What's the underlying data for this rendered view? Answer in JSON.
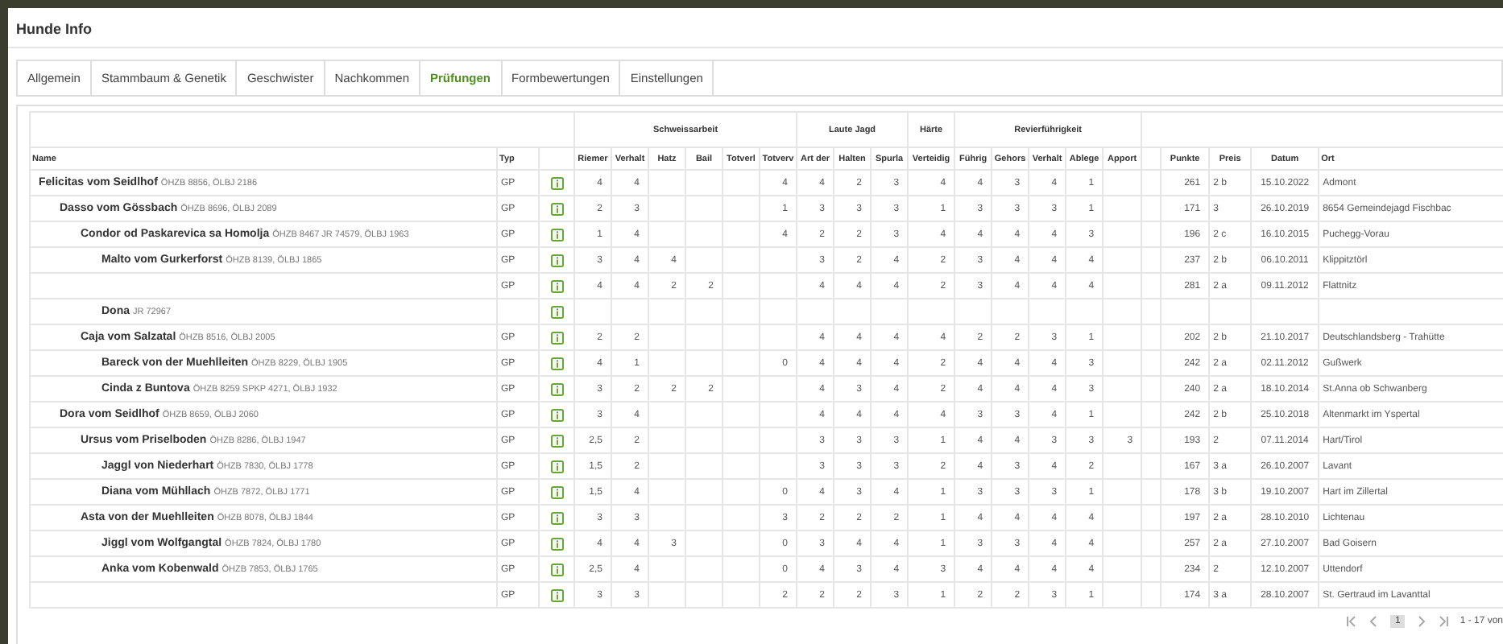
{
  "dialog": {
    "title": "Hunde Info"
  },
  "tabs": [
    {
      "label": "Allgemein",
      "selected": false
    },
    {
      "label": "Stammbaum & Genetik",
      "selected": false
    },
    {
      "label": "Geschwister",
      "selected": false
    },
    {
      "label": "Nachkommen",
      "selected": false
    },
    {
      "label": "Prüfungen",
      "selected": true
    },
    {
      "label": "Formbewertungen",
      "selected": false
    },
    {
      "label": "Einstellungen",
      "selected": false
    }
  ],
  "table": {
    "lead_columns": [
      "Name",
      "Typ"
    ],
    "column_groups": [
      {
        "label": "Schweissarbeit",
        "columns": [
          "Riemer",
          "Verhalt",
          "Hatz",
          "Bail",
          "Totverl",
          "Totverv"
        ]
      },
      {
        "label": "Laute Jagd",
        "columns": [
          "Art der",
          "Halten",
          "Spurla"
        ]
      },
      {
        "label": "Härte",
        "columns": [
          "Verteidig"
        ]
      },
      {
        "label": "Revierführigkeit",
        "columns": [
          "Führig",
          "Gehors",
          "Verhalt",
          "Ablege",
          "Apport"
        ]
      }
    ],
    "trail_columns": [
      "Punkte",
      "Preis",
      "Datum",
      "Ort"
    ],
    "rows": [
      {
        "name": "Felicitas vom Seidlhof",
        "reg": "ÖHZB 8856, ÖLBJ 2186",
        "typ": "GP",
        "scores": {
          "riemen": "4",
          "verhalten": "4",
          "totverweiser": "4",
          "art": "4",
          "halten": "2",
          "spurlaut": "3",
          "verteidigung": "4",
          "fuehrig": "4",
          "gehorsam": "3",
          "verhalten_revier": "4",
          "ablegen": "1"
        },
        "punkte": "261",
        "preis": "2 b",
        "datum": "15.10.2022",
        "ort": "Admont",
        "children": [
          {
            "name": "Dasso vom Gössbach",
            "reg": "ÖHZB 8696, ÖLBJ 2089",
            "typ": "GP",
            "scores": {
              "riemen": "2",
              "verhalten": "3",
              "totverweiser": "1",
              "art": "3",
              "halten": "3",
              "spurlaut": "3",
              "verteidigung": "1",
              "fuehrig": "3",
              "gehorsam": "3",
              "verhalten_revier": "3",
              "ablegen": "1"
            },
            "punkte": "171",
            "preis": "3",
            "datum": "26.10.2019",
            "ort": "8654 Gemeindejagd Fischbac",
            "children": [
              {
                "name": "Condor od Paskarevica sa Homolja",
                "reg": "ÖHZB 8467 JR 74579, ÖLBJ 1963",
                "typ": "GP",
                "scores": {
                  "riemen": "1",
                  "verhalten": "4",
                  "totverweiser": "4",
                  "art": "2",
                  "halten": "2",
                  "spurlaut": "3",
                  "verteidigung": "4",
                  "fuehrig": "4",
                  "gehorsam": "4",
                  "verhalten_revier": "4",
                  "ablegen": "3"
                },
                "punkte": "196",
                "preis": "2 c",
                "datum": "16.10.2015",
                "ort": "Puchegg-Vorau",
                "children": [
                  {
                    "name": "Malto vom Gurkerforst",
                    "reg": "ÖHZB 8139, ÖLBJ 1865",
                    "typ": "GP",
                    "scores": {
                      "riemen": "3",
                      "verhalten": "4",
                      "hatz": "4",
                      "art": "3",
                      "halten": "2",
                      "spurlaut": "4",
                      "verteidigung": "2",
                      "fuehrig": "3",
                      "gehorsam": "4",
                      "verhalten_revier": "4",
                      "ablegen": "4"
                    },
                    "punkte": "237",
                    "preis": "2 b",
                    "datum": "06.10.2011",
                    "ort": "Klippitztörl"
                  },
                  {
                    "typ": "GP",
                    "scores": {
                      "riemen": "4",
                      "verhalten": "4",
                      "hatz": "2",
                      "bail": "2",
                      "art": "4",
                      "halten": "4",
                      "spurlaut": "4",
                      "verteidigung": "2",
                      "fuehrig": "3",
                      "gehorsam": "4",
                      "verhalten_revier": "4",
                      "ablegen": "4"
                    },
                    "punkte": "281",
                    "preis": "2 a",
                    "datum": "09.11.2012",
                    "ort": "Flattnitz"
                  },
                  {
                    "name": "Dona",
                    "reg": "JR 72967"
                  }
                ]
              },
              {
                "name": "Caja vom Salzatal",
                "reg": "ÖHZB 8516, ÖLBJ 2005",
                "typ": "GP",
                "scores": {
                  "riemen": "2",
                  "verhalten": "2",
                  "art": "4",
                  "halten": "4",
                  "spurlaut": "4",
                  "verteidigung": "4",
                  "fuehrig": "2",
                  "gehorsam": "2",
                  "verhalten_revier": "3",
                  "ablegen": "1"
                },
                "punkte": "202",
                "preis": "2 b",
                "datum": "21.10.2017",
                "ort": "Deutschlandsberg - Trahütte",
                "children": [
                  {
                    "name": "Bareck von der Muehlleiten",
                    "reg": "ÖHZB 8229, ÖLBJ 1905",
                    "typ": "GP",
                    "scores": {
                      "riemen": "4",
                      "verhalten": "1",
                      "totverweiser": "0",
                      "art": "4",
                      "halten": "4",
                      "spurlaut": "4",
                      "verteidigung": "2",
                      "fuehrig": "4",
                      "gehorsam": "4",
                      "verhalten_revier": "4",
                      "ablegen": "3"
                    },
                    "punkte": "242",
                    "preis": "2 a",
                    "datum": "02.11.2012",
                    "ort": "Gußwerk"
                  },
                  {
                    "name": "Cinda z Buntova",
                    "reg": "ÖHZB 8259 SPKP 4271, ÖLBJ 1932",
                    "typ": "GP",
                    "scores": {
                      "riemen": "3",
                      "verhalten": "2",
                      "hatz": "2",
                      "bail": "2",
                      "art": "4",
                      "halten": "3",
                      "spurlaut": "4",
                      "verteidigung": "2",
                      "fuehrig": "4",
                      "gehorsam": "4",
                      "verhalten_revier": "4",
                      "ablegen": "3"
                    },
                    "punkte": "240",
                    "preis": "2 a",
                    "datum": "18.10.2014",
                    "ort": "St.Anna ob Schwanberg"
                  }
                ]
              }
            ]
          },
          {
            "name": "Dora vom Seidlhof",
            "reg": "ÖHZB 8659, ÖLBJ 2060",
            "typ": "GP",
            "scores": {
              "riemen": "3",
              "verhalten": "4",
              "art": "4",
              "halten": "4",
              "spurlaut": "4",
              "verteidigung": "4",
              "fuehrig": "3",
              "gehorsam": "3",
              "verhalten_revier": "4",
              "ablegen": "1"
            },
            "punkte": "242",
            "preis": "2 b",
            "datum": "25.10.2018",
            "ort": "Altenmarkt im Yspertal",
            "children": [
              {
                "name": "Ursus vom Priselboden",
                "reg": "ÖHZB 8286, ÖLBJ 1947",
                "typ": "GP",
                "scores": {
                  "riemen": "2,5",
                  "verhalten": "2",
                  "art": "3",
                  "halten": "3",
                  "spurlaut": "3",
                  "verteidigung": "1",
                  "fuehrig": "4",
                  "gehorsam": "4",
                  "verhalten_revier": "3",
                  "ablegen": "3",
                  "apport": "3"
                },
                "punkte": "193",
                "preis": "2",
                "datum": "07.11.2014",
                "ort": "Hart/Tirol",
                "children": [
                  {
                    "name": "Jaggl von Niederhart",
                    "reg": "ÖHZB 7830, ÖLBJ 1778",
                    "typ": "GP",
                    "scores": {
                      "riemen": "1,5",
                      "verhalten": "2",
                      "art": "3",
                      "halten": "3",
                      "spurlaut": "3",
                      "verteidigung": "2",
                      "fuehrig": "4",
                      "gehorsam": "3",
                      "verhalten_revier": "4",
                      "ablegen": "2"
                    },
                    "punkte": "167",
                    "preis": "3 a",
                    "datum": "26.10.2007",
                    "ort": "Lavant"
                  },
                  {
                    "name": "Diana vom Mühllach",
                    "reg": "ÖHZB 7872, ÖLBJ 1771",
                    "typ": "GP",
                    "scores": {
                      "riemen": "1,5",
                      "verhalten": "4",
                      "totverweiser": "0",
                      "art": "4",
                      "halten": "3",
                      "spurlaut": "4",
                      "verteidigung": "1",
                      "fuehrig": "3",
                      "gehorsam": "3",
                      "verhalten_revier": "3",
                      "ablegen": "1"
                    },
                    "punkte": "178",
                    "preis": "3 b",
                    "datum": "19.10.2007",
                    "ort": "Hart im Zillertal"
                  }
                ]
              },
              {
                "name": "Asta von der Muehlleiten",
                "reg": "ÖHZB 8078, ÖLBJ 1844",
                "typ": "GP",
                "scores": {
                  "riemen": "3",
                  "verhalten": "3",
                  "totverweiser": "3",
                  "art": "2",
                  "halten": "2",
                  "spurlaut": "2",
                  "verteidigung": "1",
                  "fuehrig": "4",
                  "gehorsam": "4",
                  "verhalten_revier": "4",
                  "ablegen": "4"
                },
                "punkte": "197",
                "preis": "2 a",
                "datum": "28.10.2010",
                "ort": "Lichtenau",
                "children": [
                  {
                    "name": "Jiggl vom Wolfgangtal",
                    "reg": "ÖHZB 7824, ÖLBJ 1780",
                    "typ": "GP",
                    "scores": {
                      "riemen": "4",
                      "verhalten": "4",
                      "hatz": "3",
                      "totverweiser": "0",
                      "art": "3",
                      "halten": "4",
                      "spurlaut": "4",
                      "verteidigung": "1",
                      "fuehrig": "3",
                      "gehorsam": "3",
                      "verhalten_revier": "4",
                      "ablegen": "4"
                    },
                    "punkte": "257",
                    "preis": "2 a",
                    "datum": "27.10.2007",
                    "ort": "Bad Goisern"
                  },
                  {
                    "name": "Anka vom Kobenwald",
                    "reg": "ÖHZB 7853, ÖLBJ 1765",
                    "typ": "GP",
                    "scores": {
                      "riemen": "2,5",
                      "verhalten": "4",
                      "totverweiser": "0",
                      "art": "4",
                      "halten": "3",
                      "spurlaut": "4",
                      "verteidigung": "3",
                      "fuehrig": "4",
                      "gehorsam": "4",
                      "verhalten_revier": "4",
                      "ablegen": "4"
                    },
                    "punkte": "234",
                    "preis": "2",
                    "datum": "12.10.2007",
                    "ort": "Uttendorf"
                  },
                  {
                    "typ": "GP",
                    "scores": {
                      "riemen": "3",
                      "verhalten": "3",
                      "totverweiser": "2",
                      "art": "2",
                      "halten": "2",
                      "spurlaut": "3",
                      "verteidigung": "1",
                      "fuehrig": "2",
                      "gehorsam": "2",
                      "verhalten_revier": "3",
                      "ablegen": "1"
                    },
                    "punkte": "174",
                    "preis": "3 a",
                    "datum": "28.10.2007",
                    "ort": "St. Gertraud im Lavanttal"
                  }
                ]
              }
            ]
          }
        ]
      }
    ]
  },
  "pagination": {
    "pages": [
      {
        "label": "1",
        "selected": true
      }
    ],
    "range": "1 - 17 von"
  }
}
